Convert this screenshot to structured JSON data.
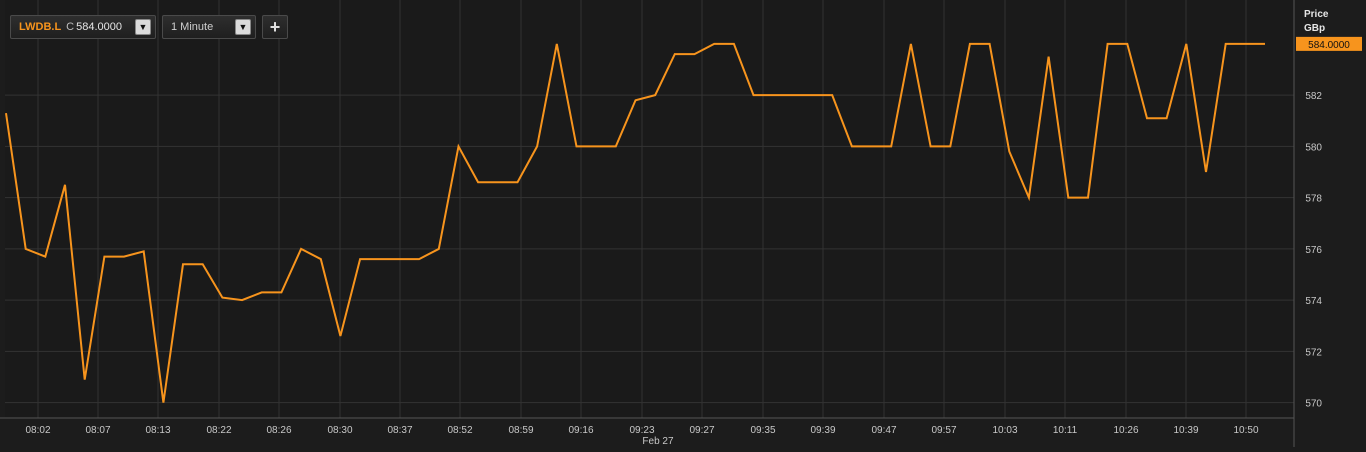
{
  "toolbar": {
    "ric": "LWDB.L",
    "quote_label": "C",
    "quote_value": "584.0000",
    "interval": "1 Minute",
    "add_label": "+",
    "dropdown_icon": "▼"
  },
  "price_axis": {
    "title_line1": "Price",
    "title_line2": "GBp",
    "last_value_label": "584.0000"
  },
  "colors": {
    "background": "#1c1c1c",
    "grid": "#333333",
    "line": "#f7941d",
    "last_price_badge": "#f7941d",
    "axis_text": "#c8c8c8"
  },
  "chart_data": {
    "type": "line",
    "title": "",
    "xlabel": "Feb 27",
    "ylabel": "Price GBp",
    "ylim": [
      569.4,
      585.4
    ],
    "y_ticks": [
      570,
      572,
      574,
      576,
      578,
      580,
      582
    ],
    "x_tick_labels": [
      "08:02",
      "08:07",
      "08:13",
      "08:22",
      "08:26",
      "08:30",
      "08:37",
      "08:52",
      "08:59",
      "09:16",
      "09:23",
      "09:27",
      "09:35",
      "09:39",
      "09:47",
      "09:57",
      "10:03",
      "10:11",
      "10:26",
      "10:39",
      "10:50"
    ],
    "grid": true,
    "series": [
      {
        "name": "LWDB.L",
        "values": [
          581.3,
          576.0,
          575.7,
          578.5,
          570.9,
          575.7,
          575.7,
          575.9,
          570.0,
          575.4,
          575.4,
          574.1,
          574.0,
          574.3,
          574.3,
          576.0,
          575.6,
          572.6,
          575.6,
          575.6,
          575.6,
          575.6,
          576.0,
          580.0,
          578.6,
          578.6,
          578.6,
          580.0,
          584.0,
          580.0,
          580.0,
          580.0,
          581.8,
          582.0,
          583.6,
          583.6,
          584.0,
          584.0,
          582.0,
          582.0,
          582.0,
          582.0,
          582.0,
          580.0,
          580.0,
          580.0,
          584.0,
          580.0,
          580.0,
          584.0,
          584.0,
          579.8,
          578.0,
          583.5,
          578.0,
          578.0,
          584.0,
          584.0,
          581.1,
          581.1,
          584.0,
          579.0,
          584.0,
          584.0,
          584.0
        ],
        "color": "#f7941d"
      }
    ]
  }
}
